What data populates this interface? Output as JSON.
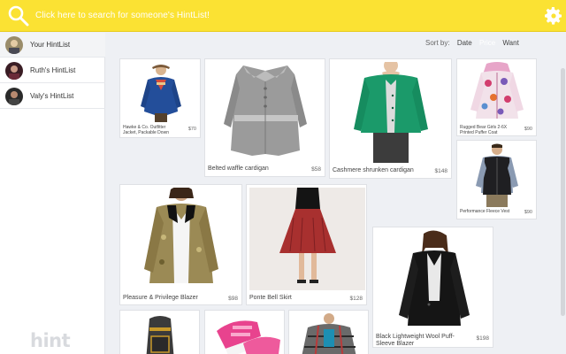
{
  "header": {
    "search_placeholder": "Click here to search for someone's HintList!"
  },
  "sidebar": {
    "items": [
      {
        "label": "Your HintList"
      },
      {
        "label": "Ruth's HintList"
      },
      {
        "label": "Valy's HintList"
      }
    ],
    "logo": "hint"
  },
  "sort": {
    "label": "Sort by:",
    "options": [
      "Date",
      "Price",
      "Want"
    ],
    "selected": "Price"
  },
  "products": [
    {
      "caption": "Hawke & Co. Outfitter Jacket, Packable Down",
      "price": "$70"
    },
    {
      "caption": "Belted waffle cardigan",
      "price": "$58"
    },
    {
      "caption": "Cashmere shrunken cardigan",
      "price": "$148"
    },
    {
      "caption": "Rugged Bear Girls 2-6X Printed Puffer Coat",
      "price": "$90"
    },
    {
      "caption": "Performance Fleece Vest",
      "price": "$90"
    },
    {
      "caption": "Pleasure & Privilege Blazer",
      "price": "$98"
    },
    {
      "caption": "Ponte Bell Skirt",
      "price": "$128"
    },
    {
      "caption": "Black Lightweight Wool Puff-Sleeve Blazer",
      "price": "$198"
    },
    {
      "caption": "",
      "price": ""
    },
    {
      "caption": "",
      "price": ""
    },
    {
      "caption": "",
      "price": ""
    }
  ],
  "colors": {
    "header": "#fbe233",
    "background": "#eef0f4"
  }
}
